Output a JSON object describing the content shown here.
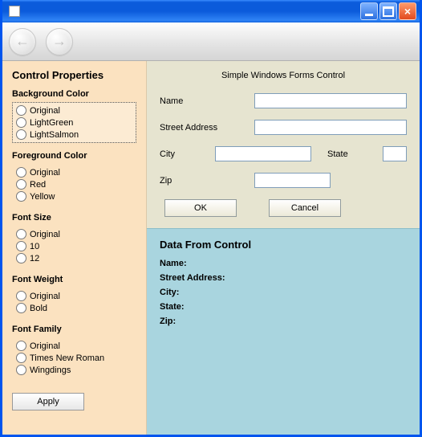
{
  "window": {
    "title": ""
  },
  "toolbar": {
    "back_label": "",
    "forward_label": ""
  },
  "sidebar": {
    "title": "Control Properties",
    "groups": {
      "bg": {
        "heading": "Background Color",
        "selected": 0,
        "options": [
          "Original",
          "LightGreen",
          "LightSalmon"
        ]
      },
      "fg": {
        "heading": "Foreground Color",
        "selected": -1,
        "options": [
          "Original",
          "Red",
          "Yellow"
        ]
      },
      "size": {
        "heading": "Font Size",
        "selected": -1,
        "options": [
          "Original",
          "10",
          "12"
        ]
      },
      "weight": {
        "heading": "Font Weight",
        "selected": -1,
        "options": [
          "Original",
          "Bold"
        ]
      },
      "family": {
        "heading": "Font Family",
        "selected": -1,
        "options": [
          "Original",
          "Times New Roman",
          "Wingdings"
        ]
      }
    },
    "apply_label": "Apply"
  },
  "form": {
    "title": "Simple Windows Forms Control",
    "labels": {
      "name": "Name",
      "street": "Street Address",
      "city": "City",
      "state": "State",
      "zip": "Zip",
      "ok": "OK",
      "cancel": "Cancel"
    },
    "values": {
      "name": "",
      "street": "",
      "city": "",
      "state": "",
      "zip": ""
    }
  },
  "data_panel": {
    "title": "Data From Control",
    "labels": {
      "name": "Name:",
      "street": "Street Address:",
      "city": "City:",
      "state": "State:",
      "zip": "Zip:"
    },
    "values": {
      "name": "",
      "street": "",
      "city": "",
      "state": "",
      "zip": ""
    }
  }
}
